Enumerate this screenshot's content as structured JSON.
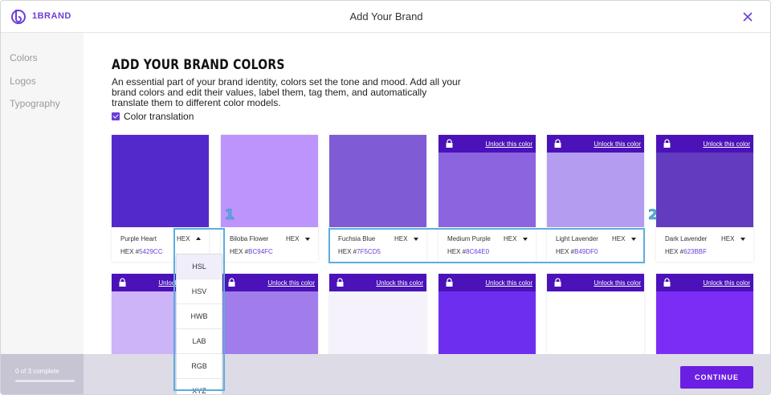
{
  "app": {
    "brand_name": "1BRAND",
    "title": "Add Your Brand"
  },
  "sidebar": {
    "items": [
      {
        "label": "Colors"
      },
      {
        "label": "Logos"
      },
      {
        "label": "Typography"
      }
    ],
    "progress_text": "0 of 3 complete",
    "progress_fraction": 0.0
  },
  "main": {
    "heading": "ADD YOUR BRAND COLORS",
    "description": "An essential part of your brand identity, colors set the tone and mood. Add all your brand colors and edit their values, label them, tag them, and automatically translate them to different color models.",
    "color_translation_label": "Color translation",
    "color_translation_checked": true
  },
  "colors": [
    {
      "name": "Purple Heart",
      "format": "HEX",
      "hex_prefix": "HEX #",
      "hex": "5429CC",
      "swatch": "#5429CC",
      "locked": false
    },
    {
      "name": "Biloba Flower",
      "format": "HEX",
      "hex_prefix": "HEX #",
      "hex": "BC94FC",
      "swatch": "#BC94FC",
      "locked": false
    },
    {
      "name": "Fuchsia Blue",
      "format": "HEX",
      "hex_prefix": "HEX #",
      "hex": "7F5CD5",
      "swatch": "#7F5CD5",
      "locked": false
    },
    {
      "name": "Medium Purple",
      "format": "HEX",
      "hex_prefix": "HEX #",
      "hex": "8C64E0",
      "swatch": "#8C64E0",
      "locked": true
    },
    {
      "name": "Light Lavender",
      "format": "HEX",
      "hex_prefix": "HEX #",
      "hex": "B49DF0",
      "swatch": "#B49DF0",
      "locked": true
    },
    {
      "name": "Dark Lavender",
      "format": "HEX",
      "hex_prefix": "HEX #",
      "hex": "623BBF",
      "swatch": "#623BBF",
      "locked": true
    }
  ],
  "second_row_swatches": [
    "#CDB3F8",
    "#A07DEA",
    "#F5F2FB",
    "#6E2EF0",
    "#FFFFFF",
    "#7B2DF5"
  ],
  "unlock_label": "Unlock this color",
  "format_dropdown": {
    "options": [
      "HSL",
      "HSV",
      "HWB",
      "LAB",
      "RGB",
      "XYZ"
    ]
  },
  "annotations": {
    "label_1": "1",
    "label_2": "2"
  },
  "continue_label": "CONTINUE",
  "theme": {
    "accent": "#6A1FE3",
    "lock_bar": "#4A12B8",
    "annotation": "#5AAEE0"
  }
}
